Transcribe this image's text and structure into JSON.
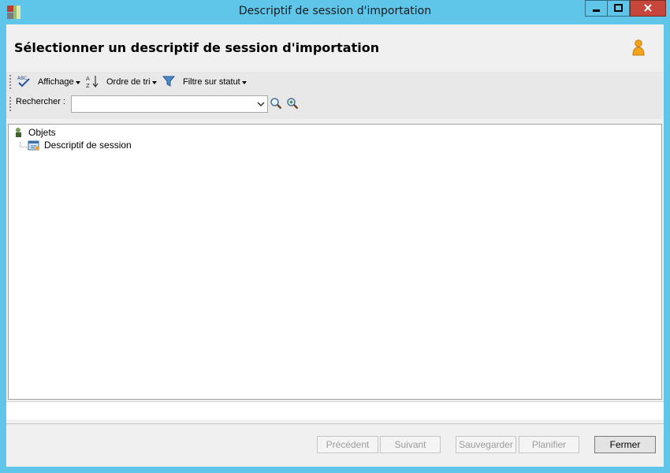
{
  "window": {
    "title": "Descriptif de session d'importation"
  },
  "header": {
    "heading": "Sélectionner un descriptif de session d'importation"
  },
  "toolbar": {
    "view_label": "Affichage",
    "sort_label": "Ordre de tri",
    "filter_label": "Filtre sur statut"
  },
  "search": {
    "label": "Rechercher :",
    "value": ""
  },
  "tree": {
    "root_label": "Objets",
    "child_label": "Descriptif de session"
  },
  "buttons": {
    "previous": "Précédent",
    "next": "Suivant",
    "save": "Sauvegarder",
    "schedule": "Planifier",
    "close": "Fermer"
  },
  "colors": {
    "titlebar": "#5fc6ea",
    "close_button": "#c7463c",
    "client_bg": "#f0f0f0"
  }
}
